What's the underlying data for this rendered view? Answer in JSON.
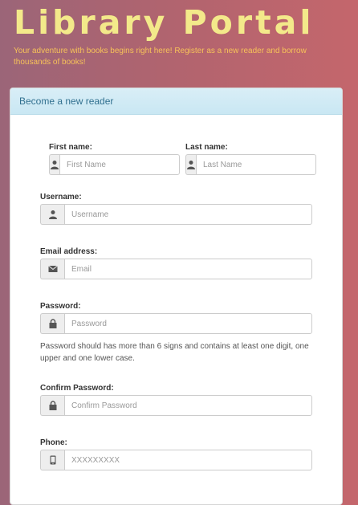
{
  "header": {
    "title": "Library Portal",
    "subtitle": "Your adventure with books begins right here! Register as a new reader and borrow thousands of books!"
  },
  "panel": {
    "heading": "Become a new reader"
  },
  "form": {
    "first_name": {
      "label": "First name:",
      "placeholder": "First Name",
      "icon": "user-icon"
    },
    "last_name": {
      "label": "Last name:",
      "placeholder": "Last Name",
      "icon": "user-icon"
    },
    "username": {
      "label": "Username:",
      "placeholder": "Username",
      "icon": "user-icon"
    },
    "email": {
      "label": "Email address:",
      "placeholder": "Email",
      "icon": "envelope-icon"
    },
    "password": {
      "label": "Password:",
      "placeholder": "Password",
      "icon": "lock-icon",
      "help": "Password should has more than 6 signs and contains at least one digit, one upper and one lower case."
    },
    "confirm_password": {
      "label": "Confirm Password:",
      "placeholder": "Confirm Password",
      "icon": "lock-icon"
    },
    "phone": {
      "label": "Phone:",
      "placeholder": "XXXXXXXXX",
      "icon": "mobile-phone-icon"
    }
  }
}
